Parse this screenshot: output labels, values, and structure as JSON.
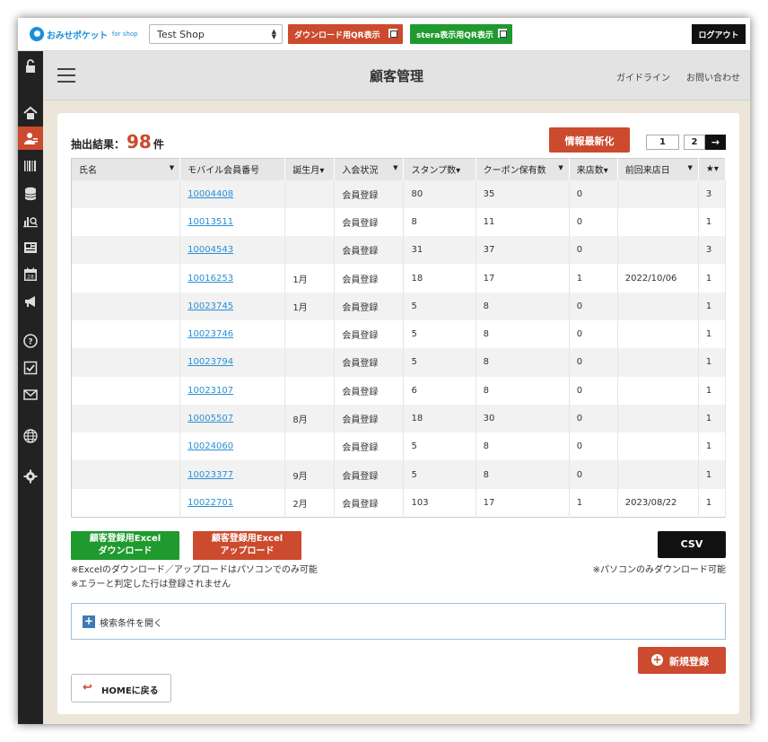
{
  "topbar": {
    "logo_text": "おみせポケット",
    "logo_sub": "for shop",
    "shop_select": "Test Shop",
    "qr_download_label": "ダウンロード用QR表示",
    "qr_stera_label": "stera表示用QR表示",
    "logout_label": "ログアウト"
  },
  "colors": {
    "accent_red": "#cc4a2d",
    "accent_green": "#1f9a2e",
    "link_blue": "#2a8fd4",
    "sidebar_bg": "#222222"
  },
  "sidebar": {
    "items": [
      {
        "icon": "unlock-icon",
        "active": false
      },
      {
        "icon": "home-icon",
        "active": false
      },
      {
        "icon": "customers-icon",
        "active": true
      },
      {
        "icon": "barcode-icon",
        "active": false
      },
      {
        "icon": "database-icon",
        "active": false
      },
      {
        "icon": "analytics-icon",
        "active": false
      },
      {
        "icon": "news-icon",
        "active": false
      },
      {
        "icon": "calendar-icon",
        "active": false
      },
      {
        "icon": "megaphone-icon",
        "active": false
      },
      {
        "icon": "help-icon",
        "active": false
      },
      {
        "icon": "checkbox-icon",
        "active": false
      },
      {
        "icon": "mail-icon",
        "active": false
      },
      {
        "icon": "globe-icon",
        "active": false
      },
      {
        "icon": "gear-icon",
        "active": false
      }
    ],
    "calendar_day": "28"
  },
  "header": {
    "title": "顧客管理",
    "guide_link": "ガイドライン",
    "contact_link": "お問い合わせ"
  },
  "main": {
    "result_label": "抽出結果：",
    "result_count": "98",
    "result_unit": "件",
    "refresh_label": "情報最新化",
    "pager": {
      "page1": "1",
      "page2": "2",
      "next": "→"
    },
    "table": {
      "columns": [
        "氏名",
        "モバイル会員番号",
        "誕生月",
        "入会状況",
        "スタンプ数",
        "クーポン保有数",
        "来店数",
        "前回来店日",
        "★"
      ],
      "rows": [
        [
          "",
          "10004408",
          "",
          "会員登録",
          "80",
          "35",
          "0",
          "",
          "3"
        ],
        [
          "",
          "10013511",
          "",
          "会員登録",
          "8",
          "11",
          "0",
          "",
          "1"
        ],
        [
          "",
          "10004543",
          "",
          "会員登録",
          "31",
          "37",
          "0",
          "",
          "3"
        ],
        [
          "",
          "10016253",
          "1月",
          "会員登録",
          "18",
          "17",
          "1",
          "2022/10/06",
          "1"
        ],
        [
          "",
          "10023745",
          "1月",
          "会員登録",
          "5",
          "8",
          "0",
          "",
          "1"
        ],
        [
          "",
          "10023746",
          "",
          "会員登録",
          "5",
          "8",
          "0",
          "",
          "1"
        ],
        [
          "",
          "10023794",
          "",
          "会員登録",
          "5",
          "8",
          "0",
          "",
          "1"
        ],
        [
          "",
          "10023107",
          "",
          "会員登録",
          "6",
          "8",
          "0",
          "",
          "1"
        ],
        [
          "",
          "10005507",
          "8月",
          "会員登録",
          "18",
          "30",
          "0",
          "",
          "1"
        ],
        [
          "",
          "10024060",
          "",
          "会員登録",
          "5",
          "8",
          "0",
          "",
          "1"
        ],
        [
          "",
          "10023377",
          "9月",
          "会員登録",
          "5",
          "8",
          "0",
          "",
          "1"
        ],
        [
          "",
          "10022701",
          "2月",
          "会員登録",
          "103",
          "17",
          "1",
          "2023/08/22",
          "1"
        ]
      ]
    },
    "excel_download_label": [
      "顧客登録用Excel",
      "ダウンロード"
    ],
    "excel_upload_label": [
      "顧客登録用Excel",
      "アップロード"
    ],
    "csv_label": "CSV",
    "note_excel": "※Excelのダウンロード／アップロードはパソコンでのみ可能",
    "note_error": "※エラーと判定した行は登録されません",
    "note_csv": "※パソコンのみダウンロード可能",
    "search_toggle_label": "検索条件を開く",
    "new_register_label": "新規登録",
    "home_back_label": "HOMEに戻る"
  }
}
